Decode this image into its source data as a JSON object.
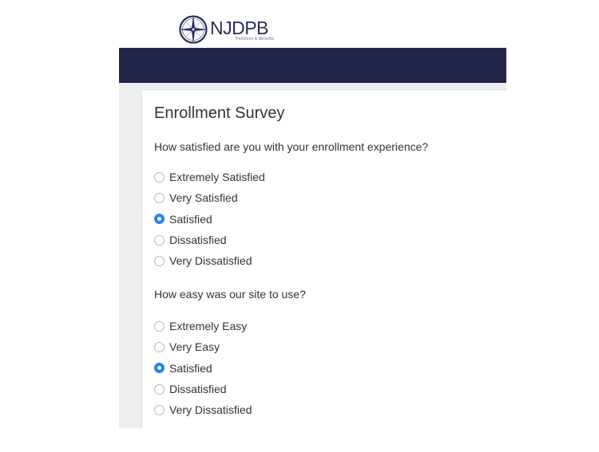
{
  "logo": {
    "text": "NJDPB",
    "tagline": "Pensions & Benefits"
  },
  "survey": {
    "title": "Enrollment Survey",
    "questions": [
      {
        "text": "How satisfied are you with your enrollment experience?",
        "options": [
          {
            "label": "Extremely Satisfied",
            "selected": false
          },
          {
            "label": "Very Satisfied",
            "selected": false
          },
          {
            "label": "Satisfied",
            "selected": true
          },
          {
            "label": "Dissatisfied",
            "selected": false
          },
          {
            "label": "Very Dissatisfied",
            "selected": false
          }
        ]
      },
      {
        "text": "How easy was our site to use?",
        "options": [
          {
            "label": "Extremely Easy",
            "selected": false
          },
          {
            "label": "Very Easy",
            "selected": false
          },
          {
            "label": "Satisfied",
            "selected": true
          },
          {
            "label": "Dissatisfied",
            "selected": false
          },
          {
            "label": "Very Dissatisfied",
            "selected": false
          }
        ]
      }
    ]
  },
  "colors": {
    "header": "#23264a",
    "accent": "#2f7df1",
    "logo": "#2a2d5c"
  },
  "icons": {
    "logo": "compass-rose-icon"
  }
}
